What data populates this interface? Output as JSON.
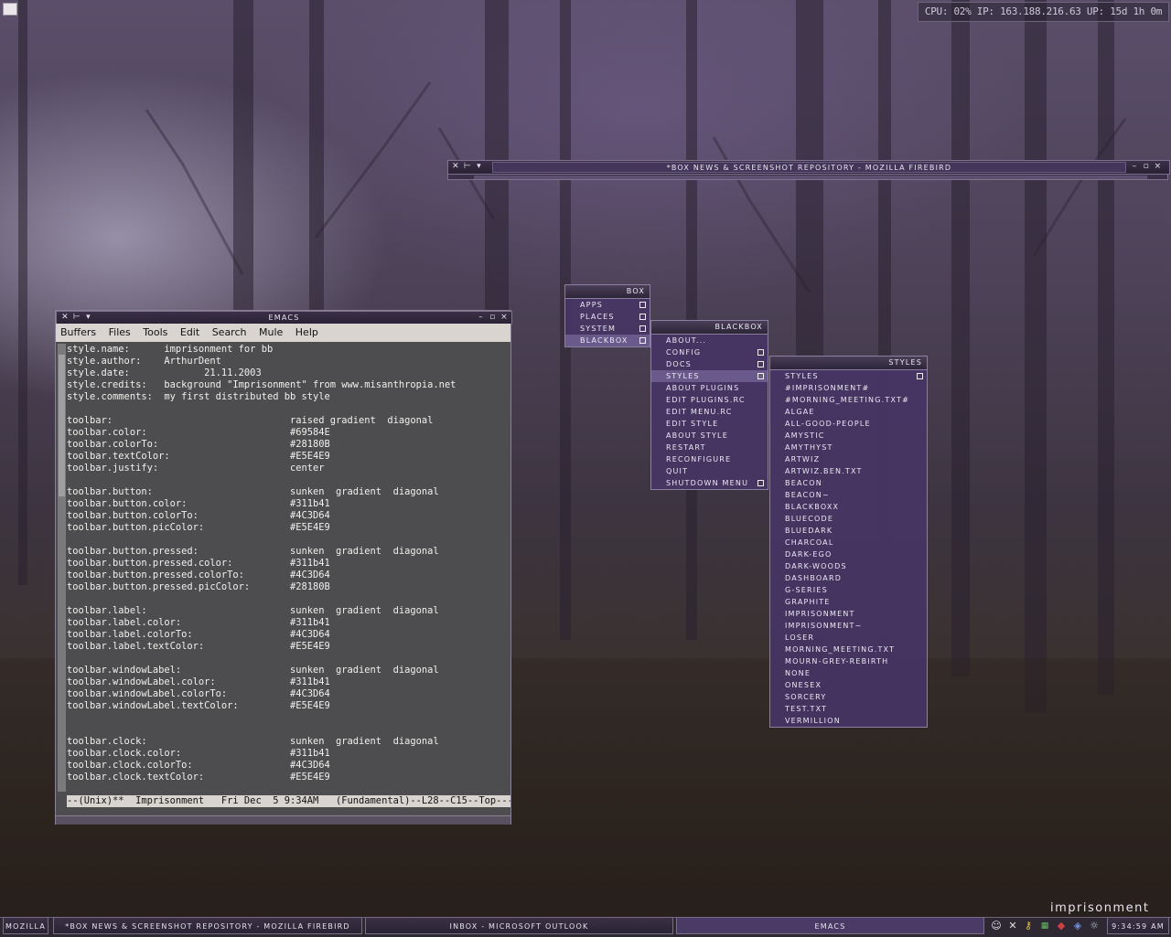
{
  "sysmon": "CPU: 02% IP: 163.188.216.63 UP: 15d 1h 0m",
  "firebird": {
    "title": "*box news & screenshot repository - mozilla firebird"
  },
  "emacs": {
    "title": "emacs",
    "menu": [
      "Buffers",
      "Files",
      "Tools",
      "Edit",
      "Search",
      "Mule",
      "Help"
    ],
    "lines": [
      "style.name:      imprisonment for bb",
      "style.author:    ArthurDent",
      "style.date:             21.11.2003",
      "style.credits:   background \"Imprisonment\" from www.misanthropia.net",
      "style.comments:  my first distributed bb style",
      "",
      "toolbar:                               raised gradient  diagonal",
      "toolbar.color:                         #69584E",
      "toolbar.colorTo:                       #28180B",
      "toolbar.textColor:                     #E5E4E9",
      "toolbar.justify:                       center",
      "",
      "toolbar.button:                        sunken  gradient  diagonal",
      "toolbar.button.color:                  #311b41",
      "toolbar.button.colorTo:                #4C3D64",
      "toolbar.button.picColor:               #E5E4E9",
      "",
      "toolbar.button.pressed:                sunken  gradient  diagonal",
      "toolbar.button.pressed.color:          #311b41",
      "toolbar.button.pressed.colorTo:        #4C3D64",
      "toolbar.button.pressed.picColor:       #28180B",
      "",
      "toolbar.label:                         sunken  gradient  diagonal",
      "toolbar.label.color:                   #311b41",
      "toolbar.label.colorTo:                 #4C3D64",
      "toolbar.label.textColor:               #E5E4E9",
      "",
      "toolbar.windowLabel:                   sunken  gradient  diagonal",
      "toolbar.windowLabel.color:             #311b41",
      "toolbar.windowLabel.colorTo:           #4C3D64",
      "toolbar.windowLabel.textColor:         #E5E4E9",
      "",
      "",
      "toolbar.clock:                         sunken  gradient  diagonal",
      "toolbar.clock.color:                   #311b41",
      "toolbar.clock.colorTo:                 #4C3D64",
      "toolbar.clock.textColor:               #E5E4E9"
    ],
    "modeline": "--(Unix)**  Imprisonment   Fri Dec  5 9:34AM   (Fundamental)--L28--C15--Top------"
  },
  "menus": {
    "box": {
      "title": "box",
      "items": [
        "apps",
        "places",
        "system",
        "blackbox"
      ]
    },
    "blackbox": {
      "title": "blackbox",
      "items": [
        "about...",
        "config",
        "docs",
        "styles",
        "about plugins",
        "edit plugins.rc",
        "edit menu.rc",
        "edit style",
        "about style",
        "restart",
        "reconfigure",
        "quit",
        "shutdown menu"
      ]
    },
    "styles": {
      "title": "styles",
      "items": [
        "styles",
        "#imprisonment#",
        "#morning_meeting.txt#",
        "algae",
        "all-good-people",
        "amystic",
        "amythyst",
        "artwiz",
        "artwiz.ben.txt",
        "beacon",
        "beacon~",
        "blackboxx",
        "bluecode",
        "bluedark",
        "charcoal",
        "dark-ego",
        "dark-woods",
        "dashboard",
        "g-series",
        "graphite",
        "imprisonment",
        "imprisonment~",
        "loser",
        "morning_meeting.txt",
        "mourn-grey-rebirth",
        "none",
        "onesex",
        "sorcery",
        "test.txt",
        "vermillion"
      ]
    }
  },
  "taskbar": {
    "tasks": [
      "mozilla",
      "*box news & screenshot repository - mozilla firebird",
      "inbox - microsoft outlook",
      "emacs"
    ],
    "clock": "9:34:59 AM",
    "brand": "imprisonment"
  }
}
